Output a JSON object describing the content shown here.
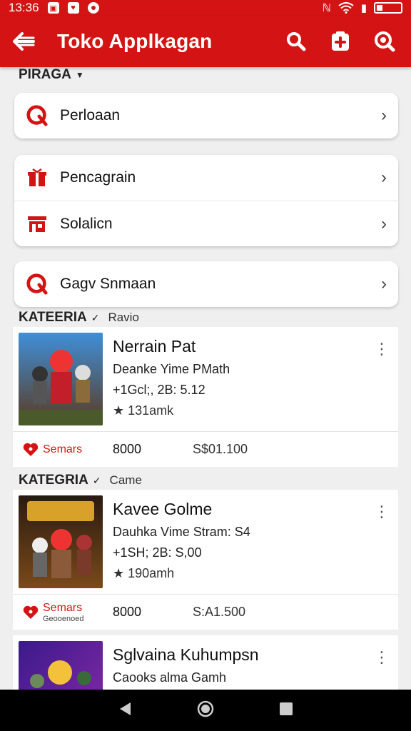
{
  "status": {
    "time": "13:36"
  },
  "appbar": {
    "title": "Toko Applkagan"
  },
  "section_top": {
    "label": "PIRAGA"
  },
  "menu": {
    "group1": [
      {
        "label": "Perloaan"
      }
    ],
    "group2": [
      {
        "label": "Pencagrain"
      },
      {
        "label": "Solalicn"
      }
    ],
    "group3": [
      {
        "label": "Gagv Snmaan"
      }
    ]
  },
  "apps": [
    {
      "category": "KATEERIA",
      "category_sub": "Ravio",
      "name": "Nerrain Pat",
      "line1": "Deanke Yime PMath",
      "line2": "+1Gcl;, 2B: 5.12",
      "rating": "★ 131amk",
      "wish": "Semars",
      "wish_sub": "",
      "price1": "8000",
      "price2": "S$01.100"
    },
    {
      "category": "KATEGRIA",
      "category_sub": "Came",
      "name": "Kavee Golme",
      "line1": "Dauhka Vime Stram: S4",
      "line2": "+1SH; 2B: S,00",
      "rating": "★ 190amh",
      "wish": "Semars",
      "wish_sub": "Geooenoed",
      "price1": "8000",
      "price2": "S:A1.500"
    },
    {
      "name": "Sglvaina Kuhumpsn",
      "line1": "Caooks alma Gamh"
    }
  ],
  "colors": {
    "primary": "#d41414",
    "surface": "#ffffff",
    "background": "#efefef"
  }
}
